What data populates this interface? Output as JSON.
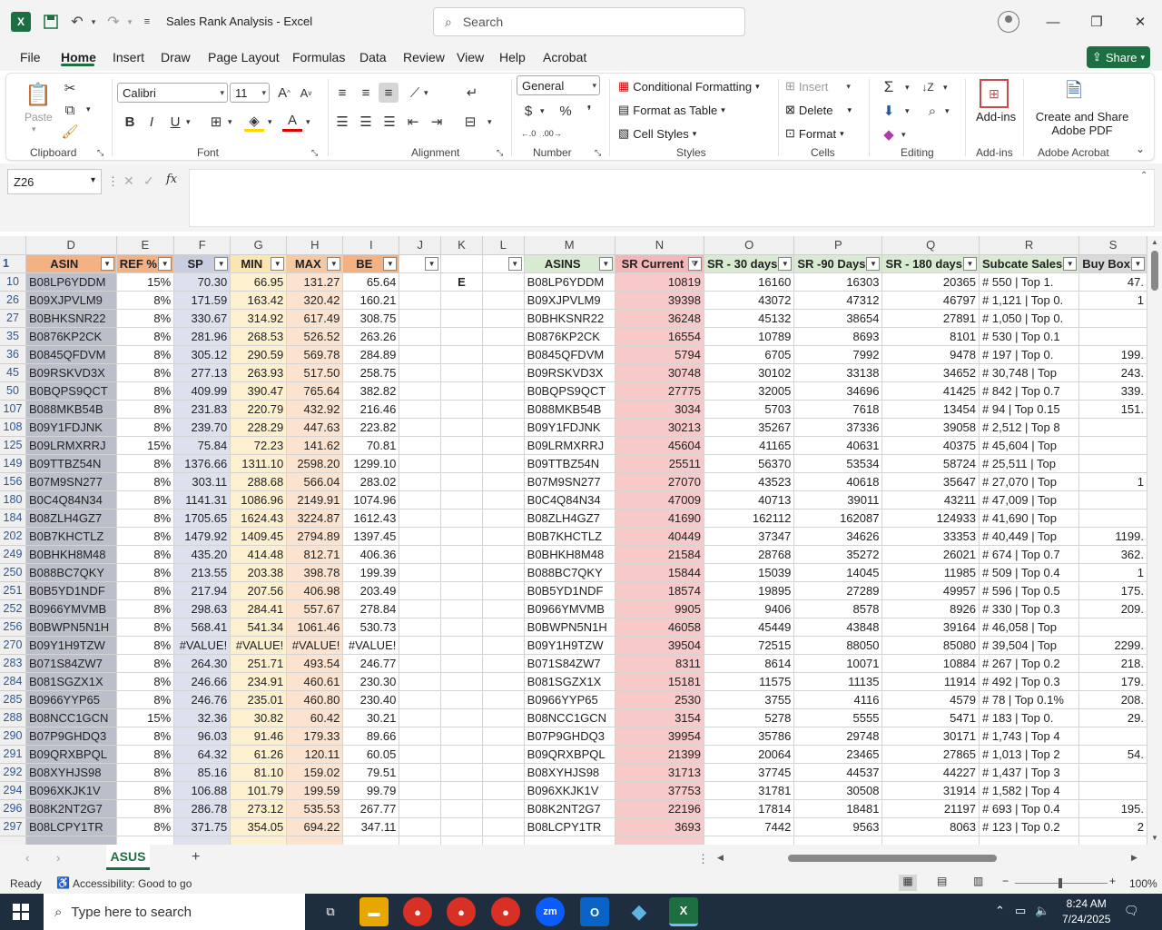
{
  "app": {
    "title": "Sales Rank Analysis  -  Excel",
    "search_placeholder": "Search"
  },
  "menu": {
    "items": [
      "File",
      "Home",
      "Insert",
      "Draw",
      "Page Layout",
      "Formulas",
      "Data",
      "Review",
      "View",
      "Help",
      "Acrobat"
    ],
    "active": "Home",
    "share_label": "Share"
  },
  "ribbon": {
    "paste_label": "Paste",
    "font_name": "Calibri",
    "font_size": "11",
    "number_format": "General",
    "conditional_formatting": "Conditional Formatting",
    "format_as_table": "Format as Table",
    "cell_styles": "Cell Styles",
    "insert": "Insert",
    "delete": "Delete",
    "format": "Format",
    "addins": "Add-ins",
    "create_share": "Create and Share",
    "adobe_pdf": "Adobe PDF",
    "groups": {
      "clipboard": "Clipboard",
      "font": "Font",
      "alignment": "Alignment",
      "number": "Number",
      "styles": "Styles",
      "cells": "Cells",
      "editing": "Editing",
      "addins": "Add-ins",
      "adobe": "Adobe Acrobat"
    }
  },
  "formula_bar": {
    "name_box": "Z26",
    "formula": ""
  },
  "grid": {
    "columns": [
      "D",
      "E",
      "F",
      "G",
      "H",
      "I",
      "J",
      "K",
      "L",
      "M",
      "N",
      "O",
      "P",
      "Q",
      "R",
      "S"
    ],
    "header_row_number": "1",
    "headers": [
      "ASIN",
      "REF %",
      "SP",
      "MIN",
      "MAX",
      "BE",
      "",
      "",
      "",
      "ASINS",
      "SR Current",
      "SR - 30 days",
      "SR -90 Days",
      "SR - 180 days",
      "Subcate Sales",
      "Buy Box"
    ],
    "k_label": "E",
    "rows": [
      {
        "r": "10",
        "asin": "B08LP6YDDM",
        "ref": "15%",
        "sp": "70.30",
        "min": "66.95",
        "max": "131.27",
        "be": "65.64",
        "asins": "B08LP6YDDM",
        "src": "10819",
        "s30": "16160",
        "s90": "16303",
        "s180": "20365",
        "sub": "# 550 | Top 1.",
        "bb": "47."
      },
      {
        "r": "26",
        "asin": "B09XJPVLM9",
        "ref": "8%",
        "sp": "171.59",
        "min": "163.42",
        "max": "320.42",
        "be": "160.21",
        "asins": "B09XJPVLM9",
        "src": "39398",
        "s30": "43072",
        "s90": "47312",
        "s180": "46797",
        "sub": "# 1,121 | Top 0.",
        "bb": "1"
      },
      {
        "r": "27",
        "asin": "B0BHKSNR22",
        "ref": "8%",
        "sp": "330.67",
        "min": "314.92",
        "max": "617.49",
        "be": "308.75",
        "asins": "B0BHKSNR22",
        "src": "36248",
        "s30": "45132",
        "s90": "38654",
        "s180": "27891",
        "sub": "# 1,050 | Top 0.",
        "bb": ""
      },
      {
        "r": "35",
        "asin": "B0876KP2CK",
        "ref": "8%",
        "sp": "281.96",
        "min": "268.53",
        "max": "526.52",
        "be": "263.26",
        "asins": "B0876KP2CK",
        "src": "16554",
        "s30": "10789",
        "s90": "8693",
        "s180": "8101",
        "sub": "# 530 | Top 0.1",
        "bb": ""
      },
      {
        "r": "36",
        "asin": "B0845QFDVM",
        "ref": "8%",
        "sp": "305.12",
        "min": "290.59",
        "max": "569.78",
        "be": "284.89",
        "asins": "B0845QFDVM",
        "src": "5794",
        "s30": "6705",
        "s90": "7992",
        "s180": "9478",
        "sub": "# 197 | Top 0.",
        "bb": "199."
      },
      {
        "r": "45",
        "asin": "B09RSKVD3X",
        "ref": "8%",
        "sp": "277.13",
        "min": "263.93",
        "max": "517.50",
        "be": "258.75",
        "asins": "B09RSKVD3X",
        "src": "30748",
        "s30": "30102",
        "s90": "33138",
        "s180": "34652",
        "sub": "# 30,748 | Top",
        "bb": "243."
      },
      {
        "r": "50",
        "asin": "B0BQPS9QCT",
        "ref": "8%",
        "sp": "409.99",
        "min": "390.47",
        "max": "765.64",
        "be": "382.82",
        "asins": "B0BQPS9QCT",
        "src": "27775",
        "s30": "32005",
        "s90": "34696",
        "s180": "41425",
        "sub": "# 842 | Top 0.7",
        "bb": "339."
      },
      {
        "r": "107",
        "asin": "B088MKB54B",
        "ref": "8%",
        "sp": "231.83",
        "min": "220.79",
        "max": "432.92",
        "be": "216.46",
        "asins": "B088MKB54B",
        "src": "3034",
        "s30": "5703",
        "s90": "7618",
        "s180": "13454",
        "sub": "# 94 | Top 0.15",
        "bb": "151."
      },
      {
        "r": "108",
        "asin": "B09Y1FDJNK",
        "ref": "8%",
        "sp": "239.70",
        "min": "228.29",
        "max": "447.63",
        "be": "223.82",
        "asins": "B09Y1FDJNK",
        "src": "30213",
        "s30": "35267",
        "s90": "37336",
        "s180": "39058",
        "sub": "# 2,512 | Top 8",
        "bb": ""
      },
      {
        "r": "125",
        "asin": "B09LRMXRRJ",
        "ref": "15%",
        "sp": "75.84",
        "min": "72.23",
        "max": "141.62",
        "be": "70.81",
        "asins": "B09LRMXRRJ",
        "src": "45604",
        "s30": "41165",
        "s90": "40631",
        "s180": "40375",
        "sub": "# 45,604 | Top",
        "bb": ""
      },
      {
        "r": "149",
        "asin": "B09TTBZ54N",
        "ref": "8%",
        "sp": "1376.66",
        "min": "1311.10",
        "max": "2598.20",
        "be": "1299.10",
        "asins": "B09TTBZ54N",
        "src": "25511",
        "s30": "56370",
        "s90": "53534",
        "s180": "58724",
        "sub": "# 25,511 | Top",
        "bb": ""
      },
      {
        "r": "156",
        "asin": "B07M9SN277",
        "ref": "8%",
        "sp": "303.11",
        "min": "288.68",
        "max": "566.04",
        "be": "283.02",
        "asins": "B07M9SN277",
        "src": "27070",
        "s30": "43523",
        "s90": "40618",
        "s180": "35647",
        "sub": "# 27,070 | Top",
        "bb": "1"
      },
      {
        "r": "180",
        "asin": "B0C4Q84N34",
        "ref": "8%",
        "sp": "1141.31",
        "min": "1086.96",
        "max": "2149.91",
        "be": "1074.96",
        "asins": "B0C4Q84N34",
        "src": "47009",
        "s30": "40713",
        "s90": "39011",
        "s180": "43211",
        "sub": "# 47,009 | Top",
        "bb": ""
      },
      {
        "r": "184",
        "asin": "B08ZLH4GZ7",
        "ref": "8%",
        "sp": "1705.65",
        "min": "1624.43",
        "max": "3224.87",
        "be": "1612.43",
        "asins": "B08ZLH4GZ7",
        "src": "41690",
        "s30": "162112",
        "s90": "162087",
        "s180": "124933",
        "sub": "# 41,690 | Top",
        "bb": ""
      },
      {
        "r": "202",
        "asin": "B0B7KHCTLZ",
        "ref": "8%",
        "sp": "1479.92",
        "min": "1409.45",
        "max": "2794.89",
        "be": "1397.45",
        "asins": "B0B7KHCTLZ",
        "src": "40449",
        "s30": "37347",
        "s90": "34626",
        "s180": "33353",
        "sub": "# 40,449 | Top",
        "bb": "1199."
      },
      {
        "r": "249",
        "asin": "B0BHKH8M48",
        "ref": "8%",
        "sp": "435.20",
        "min": "414.48",
        "max": "812.71",
        "be": "406.36",
        "asins": "B0BHKH8M48",
        "src": "21584",
        "s30": "28768",
        "s90": "35272",
        "s180": "26021",
        "sub": "# 674 | Top 0.7",
        "bb": "362."
      },
      {
        "r": "250",
        "asin": "B088BC7QKY",
        "ref": "8%",
        "sp": "213.55",
        "min": "203.38",
        "max": "398.78",
        "be": "199.39",
        "asins": "B088BC7QKY",
        "src": "15844",
        "s30": "15039",
        "s90": "14045",
        "s180": "11985",
        "sub": "# 509 | Top 0.4",
        "bb": "1"
      },
      {
        "r": "251",
        "asin": "B0B5YD1NDF",
        "ref": "8%",
        "sp": "217.94",
        "min": "207.56",
        "max": "406.98",
        "be": "203.49",
        "asins": "B0B5YD1NDF",
        "src": "18574",
        "s30": "19895",
        "s90": "27289",
        "s180": "49957",
        "sub": "# 596 | Top 0.5",
        "bb": "175."
      },
      {
        "r": "252",
        "asin": "B0966YMVMB",
        "ref": "8%",
        "sp": "298.63",
        "min": "284.41",
        "max": "557.67",
        "be": "278.84",
        "asins": "B0966YMVMB",
        "src": "9905",
        "s30": "9406",
        "s90": "8578",
        "s180": "8926",
        "sub": "# 330 | Top 0.3",
        "bb": "209."
      },
      {
        "r": "256",
        "asin": "B0BWPN5N1H",
        "ref": "8%",
        "sp": "568.41",
        "min": "541.34",
        "max": "1061.46",
        "be": "530.73",
        "asins": "B0BWPN5N1H",
        "src": "46058",
        "s30": "45449",
        "s90": "43848",
        "s180": "39164",
        "sub": "# 46,058 | Top",
        "bb": ""
      },
      {
        "r": "270",
        "asin": "B09Y1H9TZW",
        "ref": "8%",
        "sp": "#VALUE!",
        "min": "#VALUE!",
        "max": "#VALUE!",
        "be": "#VALUE!",
        "asins": "B09Y1H9TZW",
        "src": "39504",
        "s30": "72515",
        "s90": "88050",
        "s180": "85080",
        "sub": "# 39,504 | Top",
        "bb": "2299."
      },
      {
        "r": "283",
        "asin": "B071S84ZW7",
        "ref": "8%",
        "sp": "264.30",
        "min": "251.71",
        "max": "493.54",
        "be": "246.77",
        "asins": "B071S84ZW7",
        "src": "8311",
        "s30": "8614",
        "s90": "10071",
        "s180": "10884",
        "sub": "# 267 | Top 0.2",
        "bb": "218."
      },
      {
        "r": "284",
        "asin": "B081SGZX1X",
        "ref": "8%",
        "sp": "246.66",
        "min": "234.91",
        "max": "460.61",
        "be": "230.30",
        "asins": "B081SGZX1X",
        "src": "15181",
        "s30": "11575",
        "s90": "11135",
        "s180": "11914",
        "sub": "# 492 | Top 0.3",
        "bb": "179."
      },
      {
        "r": "285",
        "asin": "B0966YYP65",
        "ref": "8%",
        "sp": "246.76",
        "min": "235.01",
        "max": "460.80",
        "be": "230.40",
        "asins": "B0966YYP65",
        "src": "2530",
        "s30": "3755",
        "s90": "4116",
        "s180": "4579",
        "sub": "# 78 | Top 0.1%",
        "bb": "208."
      },
      {
        "r": "288",
        "asin": "B08NCC1GCN",
        "ref": "15%",
        "sp": "32.36",
        "min": "30.82",
        "max": "60.42",
        "be": "30.21",
        "asins": "B08NCC1GCN",
        "src": "3154",
        "s30": "5278",
        "s90": "5555",
        "s180": "5471",
        "sub": "# 183 | Top 0.",
        "bb": "29."
      },
      {
        "r": "290",
        "asin": "B07P9GHDQ3",
        "ref": "8%",
        "sp": "96.03",
        "min": "91.46",
        "max": "179.33",
        "be": "89.66",
        "asins": "B07P9GHDQ3",
        "src": "39954",
        "s30": "35786",
        "s90": "29748",
        "s180": "30171",
        "sub": "# 1,743 | Top 4",
        "bb": ""
      },
      {
        "r": "291",
        "asin": "B09QRXBPQL",
        "ref": "8%",
        "sp": "64.32",
        "min": "61.26",
        "max": "120.11",
        "be": "60.05",
        "asins": "B09QRXBPQL",
        "src": "21399",
        "s30": "20064",
        "s90": "23465",
        "s180": "27865",
        "sub": "# 1,013 | Top 2",
        "bb": "54."
      },
      {
        "r": "292",
        "asin": "B08XYHJS98",
        "ref": "8%",
        "sp": "85.16",
        "min": "81.10",
        "max": "159.02",
        "be": "79.51",
        "asins": "B08XYHJS98",
        "src": "31713",
        "s30": "37745",
        "s90": "44537",
        "s180": "44227",
        "sub": "# 1,437 | Top 3",
        "bb": ""
      },
      {
        "r": "294",
        "asin": "B096XKJK1V",
        "ref": "8%",
        "sp": "106.88",
        "min": "101.79",
        "max": "199.59",
        "be": "99.79",
        "asins": "B096XKJK1V",
        "src": "37753",
        "s30": "31781",
        "s90": "30508",
        "s180": "31914",
        "sub": "# 1,582 | Top 4",
        "bb": ""
      },
      {
        "r": "296",
        "asin": "B08K2NT2G7",
        "ref": "8%",
        "sp": "286.78",
        "min": "273.12",
        "max": "535.53",
        "be": "267.77",
        "asins": "B08K2NT2G7",
        "src": "22196",
        "s30": "17814",
        "s90": "18481",
        "s180": "21197",
        "sub": "# 693 | Top 0.4",
        "bb": "195."
      },
      {
        "r": "297",
        "asin": "B08LCPY1TR",
        "ref": "8%",
        "sp": "371.75",
        "min": "354.05",
        "max": "694.22",
        "be": "347.11",
        "asins": "B08LCPY1TR",
        "src": "3693",
        "s30": "7442",
        "s90": "9563",
        "s180": "8063",
        "sub": "# 123 | Top 0.2",
        "bb": "2"
      }
    ]
  },
  "sheet": {
    "tab": "ASUS"
  },
  "status": {
    "ready": "Ready",
    "accessibility": "Accessibility: Good to go",
    "zoom": "100%"
  },
  "taskbar": {
    "search_placeholder": "Type here to search",
    "time": "8:24 AM",
    "date": "7/24/2025"
  },
  "colors": {
    "excel_green": "#1d6f42",
    "sr_current_fill": "#f8c9c9",
    "asin_fill": "#bbbfc9"
  }
}
